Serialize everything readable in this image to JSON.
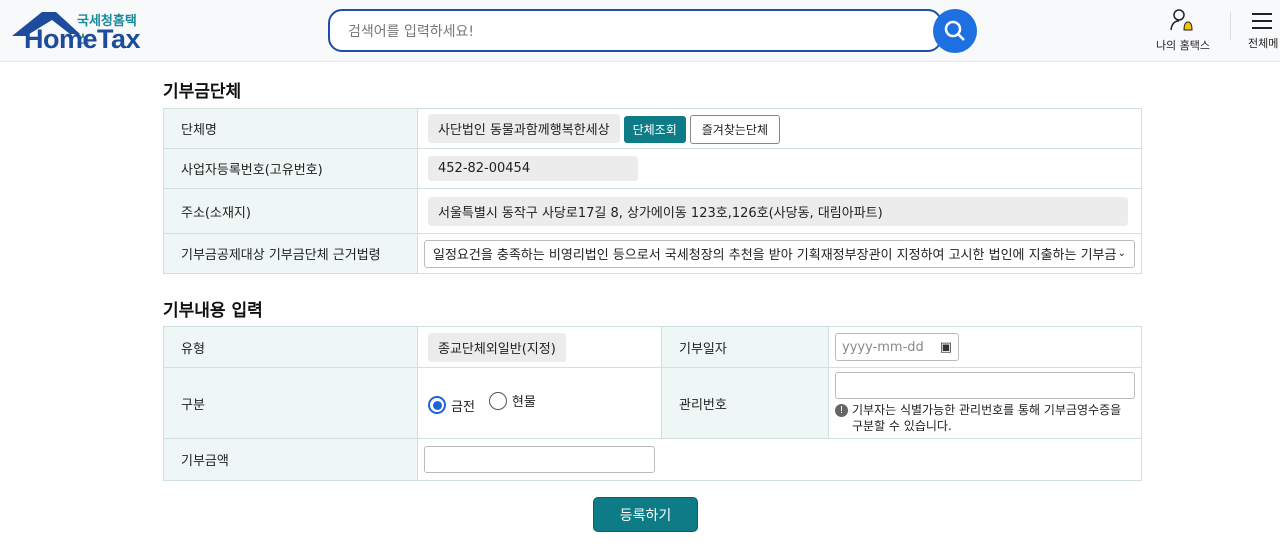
{
  "header": {
    "logo_sub": "국세청홈택스",
    "logo_main": "HomeTax",
    "search_placeholder": "검색어를 입력하세요!",
    "my_hometax": "나의 홈택스",
    "all_menu": "전체메"
  },
  "org": {
    "title": "기부금단체",
    "name_label": "단체명",
    "name_value": "사단법인 동물과함께행복한세상",
    "search_btn": "단체조회",
    "favorite_btn": "즐겨찾는단체",
    "bizno_label": "사업자등록번호(고유번호)",
    "bizno_value": "452-82-00454",
    "addr_label": "주소(소재지)",
    "addr_value": "서울특별시 동작구 사당로17길 8, 상가에이동 123호,126호(사당동, 대림아파트)",
    "law_label": "기부금공제대상 기부금단체 근거법령",
    "law_value": "일정요건을 충족하는 비영리법인 등으로서 국세청장의 추천을 받아 기획재정부장관이 지정하여 고시한 법인에 지출하는 기부금"
  },
  "donation": {
    "title": "기부내용 입력",
    "type_label": "유형",
    "type_value": "종교단체외일반(지정)",
    "date_label": "기부일자",
    "date_placeholder": "yyyy-mm-dd",
    "kind_label": "구분",
    "kind_options": [
      "금전",
      "현물"
    ],
    "kind_selected": "금전",
    "mgmt_label": "관리번호",
    "mgmt_note": "기부자는 식별가능한 관리번호를 통해 기부금영수증을 구분할 수 있습니다.",
    "amount_label": "기부금액",
    "submit": "등록하기"
  },
  "colors": {
    "accent": "#0e7c86",
    "brand": "#1d4c9c"
  }
}
